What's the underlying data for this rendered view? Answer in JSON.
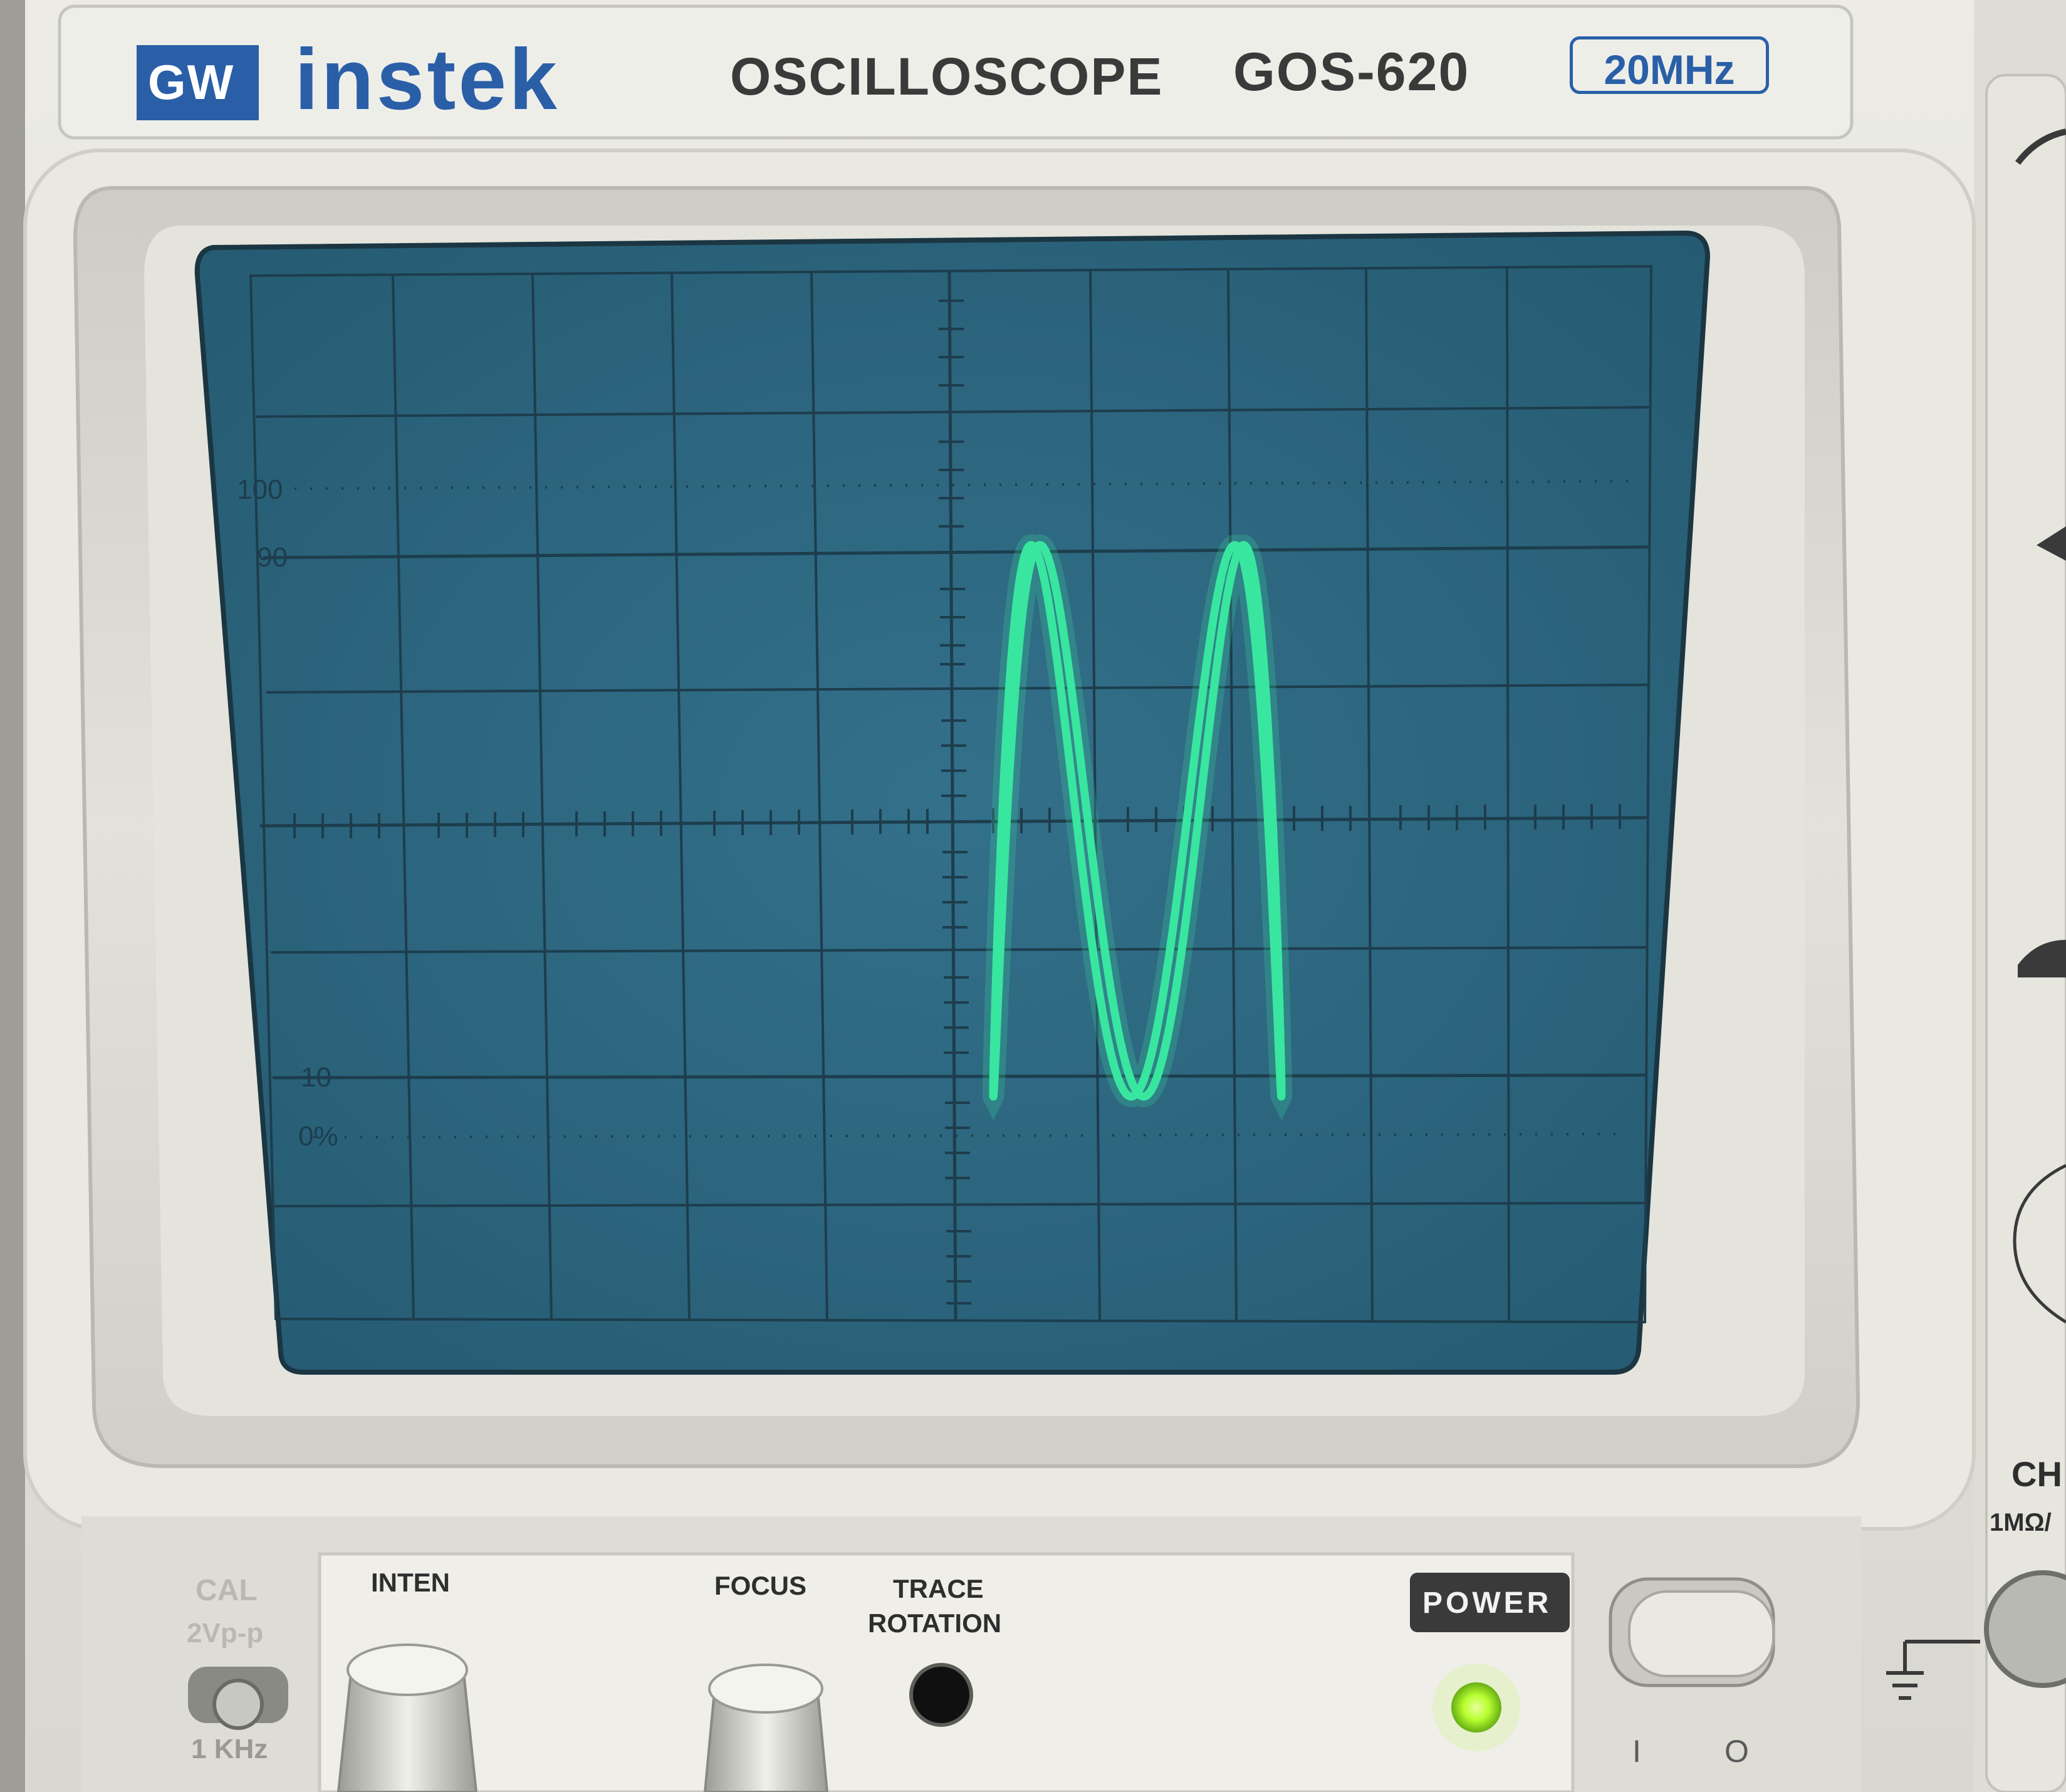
{
  "brand": {
    "logo_badge": "GW",
    "logo_word": "instek",
    "product_type": "OSCILLOSCOPE",
    "model": "GOS-620",
    "bandwidth_badge": "20MHz"
  },
  "graticule": {
    "label_100": "100",
    "label_90": "90",
    "label_10": "10",
    "label_0": "0%"
  },
  "front_panel": {
    "cal_label": "CAL",
    "cal_value": "2Vp-p",
    "cal_freq": "1 KHz",
    "inten_label": "INTEN",
    "focus_label": "FOCUS",
    "trace_rotation_line1": "TRACE",
    "trace_rotation_line2": "ROTATION",
    "power_label": "POWER",
    "switch_on_symbol": "I",
    "switch_off_symbol": "O",
    "ch_label": "CH",
    "input_impedance": "1MΩ/"
  },
  "colors": {
    "bezel": "#e8e7e0",
    "screen": "#2f6a82",
    "trace": "#39e6a0",
    "power_led": "#b8ff30",
    "brand_blue": "#2a5fa8"
  },
  "icons": {
    "ground_symbol": "ground-icon",
    "power_led": "led-indicator-icon"
  }
}
